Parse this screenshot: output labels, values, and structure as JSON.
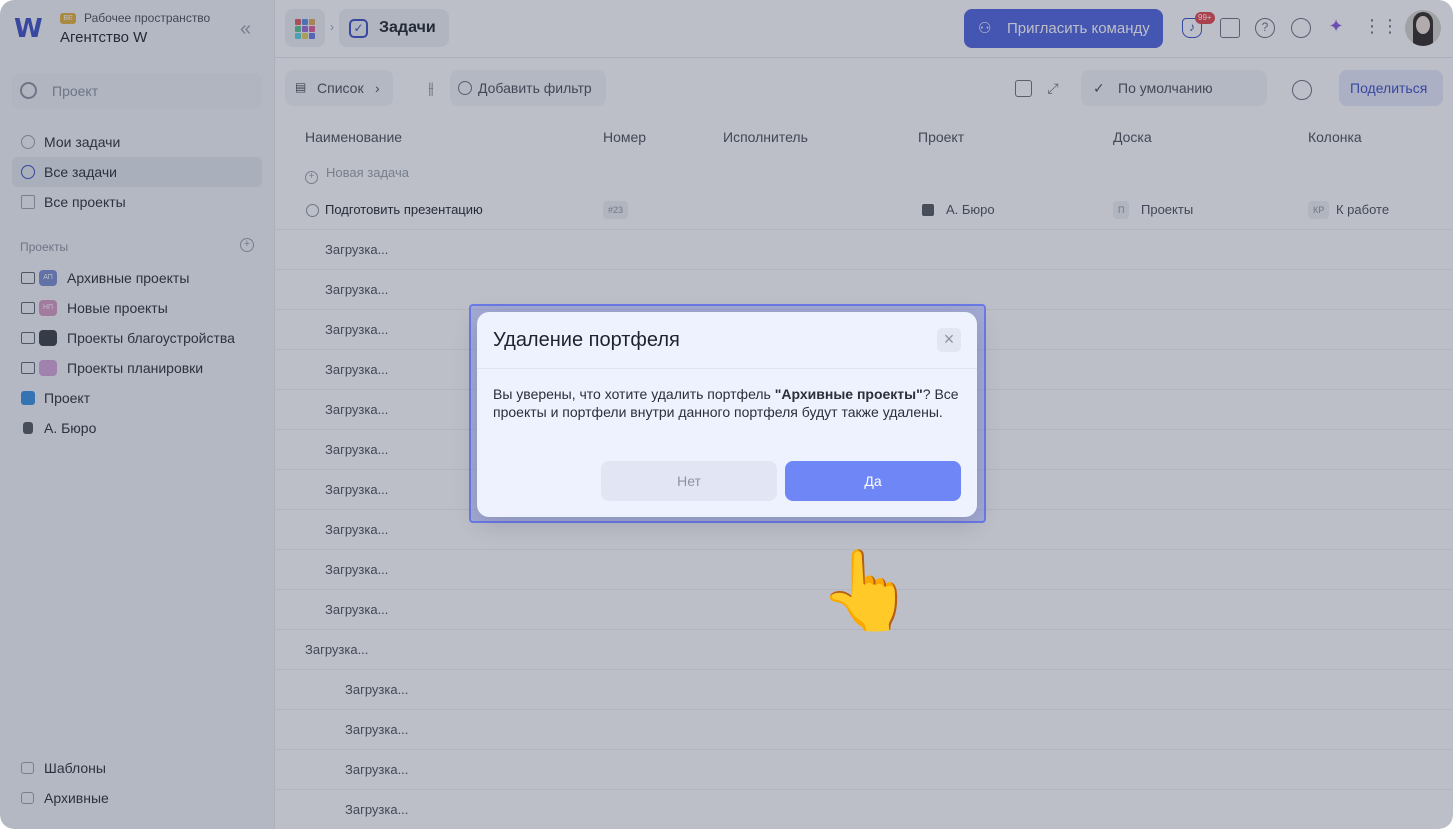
{
  "workspace": {
    "badge": "ВЕ",
    "subtitle": "Рабочее пространство",
    "name": "Агентство W"
  },
  "sidebar": {
    "search_placeholder": "Проект",
    "nav": [
      {
        "label": "Мои задачи"
      },
      {
        "label": "Все задачи"
      },
      {
        "label": "Все проекты"
      }
    ],
    "projects_title": "Проекты",
    "projects": [
      {
        "label": "Архивные проекты",
        "thumb": "АП"
      },
      {
        "label": "Новые проекты",
        "thumb": "НП"
      },
      {
        "label": "Проекты благоустройства",
        "thumb": ""
      },
      {
        "label": "Проекты планировки",
        "thumb": ""
      },
      {
        "label": "Проект"
      },
      {
        "label": "А. Бюро"
      }
    ],
    "bottom": [
      {
        "label": "Шаблоны"
      },
      {
        "label": "Архивные"
      }
    ]
  },
  "topbar": {
    "tab_label": "Задачи",
    "invite_label": "Пригласить команду",
    "notif_count": "99+"
  },
  "toolbar": {
    "view_label": "Список",
    "filter_label": "Добавить фильтр",
    "sort_label": "По умолчанию",
    "share_label": "Поделиться"
  },
  "table": {
    "columns": [
      "Наименование",
      "Номер",
      "Исполнитель",
      "Проект",
      "Доска",
      "Колонка"
    ],
    "new_task": "Новая задача",
    "first_row": {
      "name": "Подготовить презентацию",
      "number": "#23",
      "project": "А. Бюро",
      "board_chip": "П",
      "board": "Проекты",
      "column_chip": "КР",
      "column": "К работе"
    },
    "loading": "Загрузка..."
  },
  "modal": {
    "title": "Удаление портфеля",
    "body_pre": "Вы уверены, что хотите удалить портфель ",
    "body_bold": "\"Архивные проекты\"",
    "body_post": "? Все проекты и портфели внутри данного портфеля будут также удалены.",
    "no_label": "Нет",
    "yes_label": "Да",
    "close_symbol": "×"
  },
  "pointer": {
    "glyph": "👆"
  }
}
